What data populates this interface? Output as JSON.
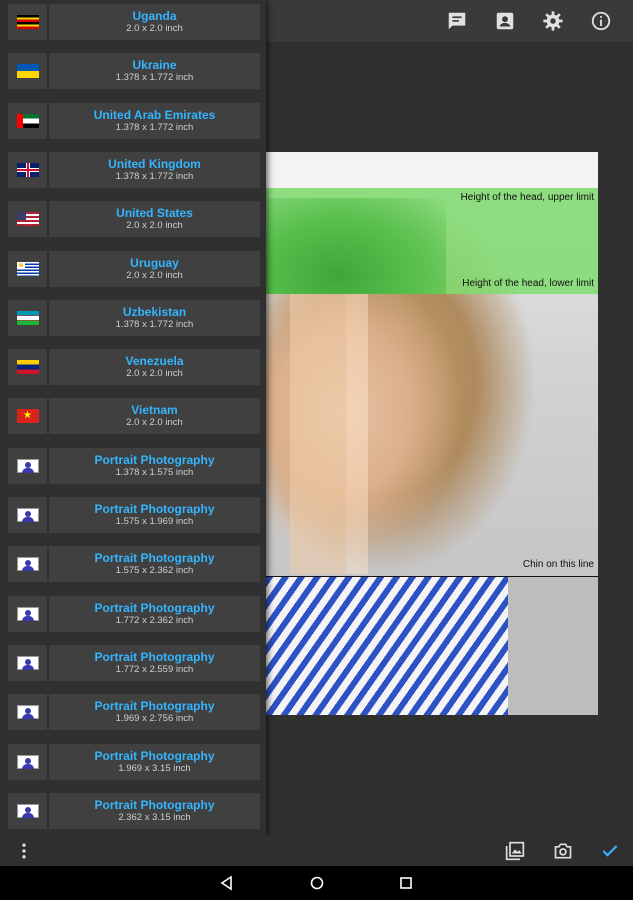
{
  "toolbar": {
    "icons": [
      "chat-icon",
      "account-box-icon",
      "gear-icon",
      "info-icon"
    ]
  },
  "preview": {
    "labels": {
      "head_upper": "Height of the head, upper limit",
      "head_lower": "Height of the head, lower limit",
      "chin": "Chin on this line"
    }
  },
  "countries": [
    {
      "name": "Uganda",
      "size": "2.0 x 2.0 inch",
      "flag": "uganda"
    },
    {
      "name": "Ukraine",
      "size": "1.378 x 1.772 inch",
      "flag": "ukraine"
    },
    {
      "name": "United Arab Emirates",
      "size": "1.378 x 1.772 inch",
      "flag": "uae"
    },
    {
      "name": "United Kingdom",
      "size": "1.378 x 1.772 inch",
      "flag": "uk"
    },
    {
      "name": "United States",
      "size": "2.0 x 2.0 inch",
      "flag": "usa"
    },
    {
      "name": "Uruguay",
      "size": "2.0 x 2.0 inch",
      "flag": "uruguay"
    },
    {
      "name": "Uzbekistan",
      "size": "1.378 x 1.772 inch",
      "flag": "uzbekistan"
    },
    {
      "name": "Venezuela",
      "size": "2.0 x 2.0 inch",
      "flag": "venezuela"
    },
    {
      "name": "Vietnam",
      "size": "2.0 x 2.0 inch",
      "flag": "vietnam"
    },
    {
      "name": "Portrait Photography",
      "size": "1.378 x 1.575 inch",
      "flag": "portrait"
    },
    {
      "name": "Portrait Photography",
      "size": "1.575 x 1.969 inch",
      "flag": "portrait"
    },
    {
      "name": "Portrait Photography",
      "size": "1.575 x 2.362 inch",
      "flag": "portrait"
    },
    {
      "name": "Portrait Photography",
      "size": "1.772 x 2.362 inch",
      "flag": "portrait"
    },
    {
      "name": "Portrait Photography",
      "size": "1.772 x 2.559 inch",
      "flag": "portrait"
    },
    {
      "name": "Portrait Photography",
      "size": "1.969 x 2.756 inch",
      "flag": "portrait"
    },
    {
      "name": "Portrait Photography",
      "size": "1.969 x 3.15 inch",
      "flag": "portrait"
    },
    {
      "name": "Portrait Photography",
      "size": "2.362 x 3.15 inch",
      "flag": "portrait"
    }
  ],
  "bottom_bar": {
    "icons": [
      "more-vert-icon",
      "gallery-icon",
      "camera-icon",
      "check-icon"
    ]
  },
  "nav_bar": {
    "icons": [
      "back-icon",
      "home-icon",
      "recents-icon"
    ]
  },
  "colors": {
    "accent": "#34b5ff",
    "check": "#34b5ff",
    "row_bg": "#404040",
    "background": "#303030"
  }
}
